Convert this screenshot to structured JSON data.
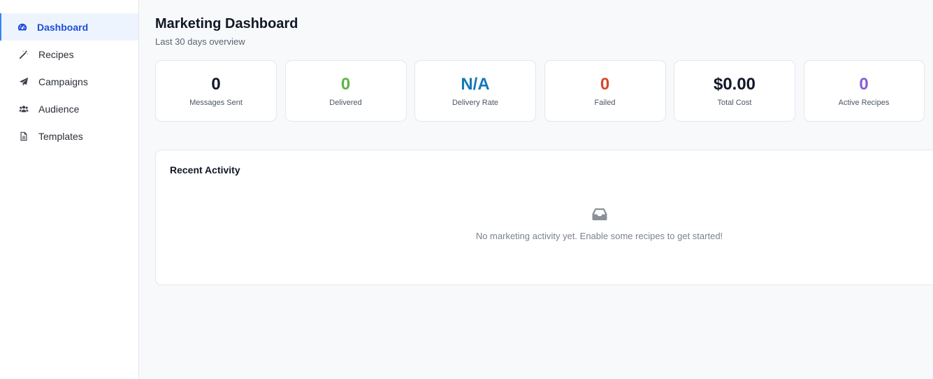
{
  "sidebar": {
    "items": [
      {
        "label": "Dashboard",
        "icon": "gauge-icon",
        "active": true
      },
      {
        "label": "Recipes",
        "icon": "magic-wand-icon"
      },
      {
        "label": "Campaigns",
        "icon": "paper-plane-icon"
      },
      {
        "label": "Audience",
        "icon": "users-icon"
      },
      {
        "label": "Templates",
        "icon": "document-icon"
      }
    ]
  },
  "header": {
    "title": "Marketing Dashboard",
    "subtitle": "Last 30 days overview"
  },
  "stats": [
    {
      "value": "0",
      "label": "Messages Sent",
      "color": "#111827"
    },
    {
      "value": "0",
      "label": "Delivered",
      "color": "#5fb346"
    },
    {
      "value": "N/A",
      "label": "Delivery Rate",
      "color": "#1478b8"
    },
    {
      "value": "0",
      "label": "Failed",
      "color": "#d9472b"
    },
    {
      "value": "$0.00",
      "label": "Total Cost",
      "color": "#111827"
    },
    {
      "value": "0",
      "label": "Active Recipes",
      "color": "#8a5cd6"
    }
  ],
  "activity": {
    "title": "Recent Activity",
    "empty_icon": "inbox-icon",
    "empty_text": "No marketing activity yet. Enable some recipes to get started!"
  },
  "colors": {
    "accent": "#3b82f6",
    "active_bg": "#eef4fd"
  }
}
